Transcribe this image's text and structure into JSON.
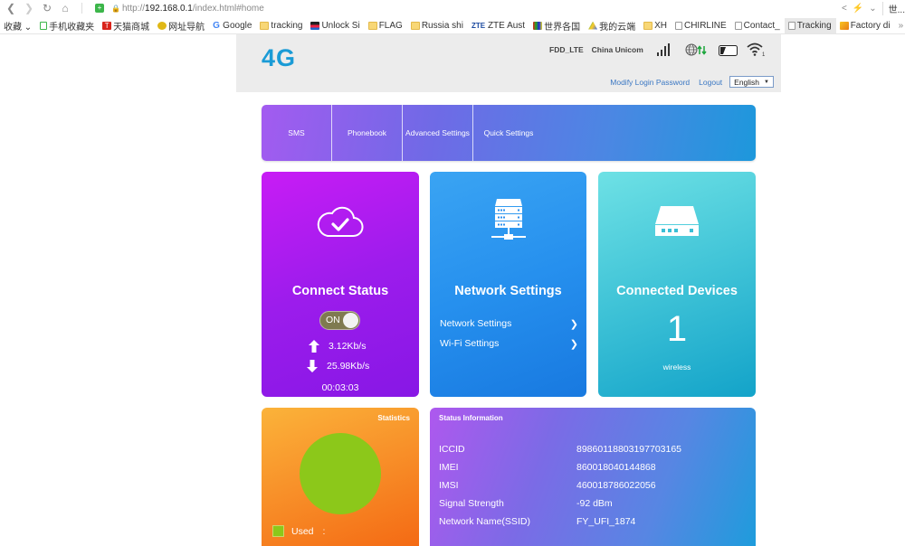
{
  "browser": {
    "url_prefix": "http://",
    "url_host": "192.168.0.1",
    "url_path": "/index.html#home",
    "right_text": "世...",
    "bookmarks": [
      {
        "label": "收藏 ⌄",
        "icon": "none"
      },
      {
        "label": "手机收藏夹",
        "icon": "phone"
      },
      {
        "label": "天猫商城",
        "icon": "tmall"
      },
      {
        "label": "网址导航",
        "icon": "nav"
      },
      {
        "label": "Google",
        "icon": "g"
      },
      {
        "label": "tracking",
        "icon": "folder"
      },
      {
        "label": "Unlock Si",
        "icon": "bag"
      },
      {
        "label": "FLAG",
        "icon": "folder"
      },
      {
        "label": "Russia shi",
        "icon": "folder"
      },
      {
        "label": "ZTE Aust",
        "icon": "zte"
      },
      {
        "label": "世界各国",
        "icon": "world"
      },
      {
        "label": "我的云端",
        "icon": "drive"
      },
      {
        "label": "XH",
        "icon": "folder"
      },
      {
        "label": "CHIRLINE",
        "icon": "page"
      },
      {
        "label": "Contact_",
        "icon": "page"
      },
      {
        "label": "Tracking",
        "icon": "page",
        "active": true
      },
      {
        "label": "Factory di",
        "icon": "fact"
      }
    ],
    "more_label": "»"
  },
  "header": {
    "logo": "4G",
    "network_type": "FDD_LTE",
    "carrier": "China Unicom",
    "wifi_clients": "1",
    "modify_password_link": "Modify Login Password",
    "logout_link": "Logout",
    "language": "English"
  },
  "nav_tabs": [
    {
      "label": "SMS"
    },
    {
      "label": "Phonebook"
    },
    {
      "label": "Advanced Settings"
    },
    {
      "label": "Quick Settings"
    }
  ],
  "connect_card": {
    "title": "Connect Status",
    "toggle_label": "ON",
    "upload_speed": "3.12Kb/s",
    "download_speed": "25.98Kb/s",
    "connected_time": "00:03:03"
  },
  "network_card": {
    "title": "Network Settings",
    "links": [
      {
        "label": "Network Settings"
      },
      {
        "label": "Wi-Fi Settings"
      }
    ]
  },
  "devices_card": {
    "title": "Connected Devices",
    "count": "1",
    "type": "wireless"
  },
  "stats_card": {
    "title": "Statistics",
    "legend_label": "Used",
    "legend_sep": ":",
    "used_color": "#8cc81a"
  },
  "status_card": {
    "title": "Status Information",
    "rows": [
      {
        "key": "ICCID",
        "value": "89860118803197703165"
      },
      {
        "key": "IMEI",
        "value": "860018040144868"
      },
      {
        "key": "IMSI",
        "value": "460018786022056"
      },
      {
        "key": "Signal Strength",
        "value": "-92 dBm"
      },
      {
        "key": "Network Name(SSID)",
        "value": "FY_UFI_1874"
      }
    ]
  }
}
